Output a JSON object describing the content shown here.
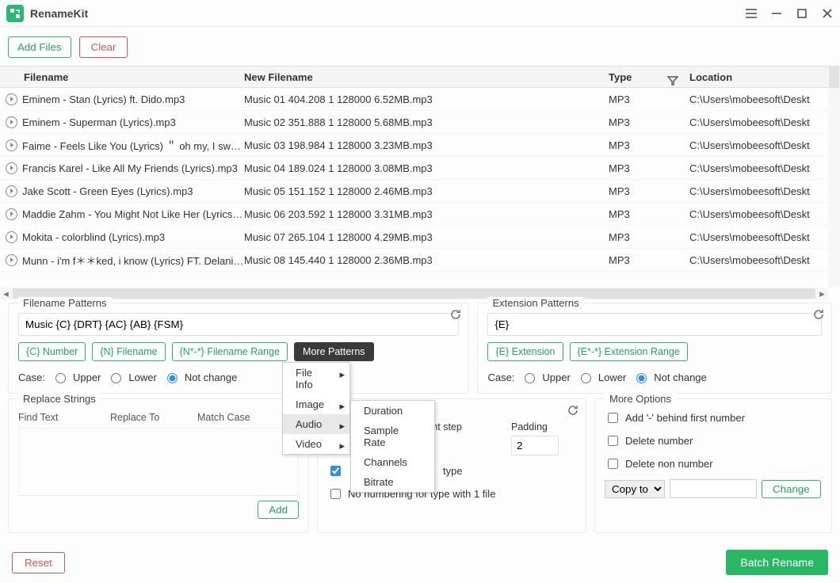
{
  "app": {
    "title": "RenameKit"
  },
  "toolbar": {
    "add_files": "Add Files",
    "clear": "Clear"
  },
  "columns": {
    "filename": "Filename",
    "new_filename": "New Filename",
    "type": "Type",
    "location": "Location"
  },
  "rows": [
    {
      "file": "Eminem - Stan (Lyrics) ft. Dido.mp3",
      "newf": "Music 01 404.208 1 128000 6.52MB.mp3",
      "type": "MP3",
      "loc": "C:\\Users\\mobeesoft\\Deskt"
    },
    {
      "file": "Eminem - Superman (Lyrics).mp3",
      "newf": "Music 02 351.888 1 128000 5.68MB.mp3",
      "type": "MP3",
      "loc": "C:\\Users\\mobeesoft\\Deskt"
    },
    {
      "file": "Faime - Feels Like You (Lyrics) ＂ oh my, I swear I ca",
      "newf": "Music 03 198.984 1 128000 3.23MB.mp3",
      "type": "MP3",
      "loc": "C:\\Users\\mobeesoft\\Deskt"
    },
    {
      "file": "Francis Karel - Like All My Friends (Lyrics).mp3",
      "newf": "Music 04 189.024 1 128000 3.08MB.mp3",
      "type": "MP3",
      "loc": "C:\\Users\\mobeesoft\\Deskt"
    },
    {
      "file": "Jake Scott - Green Eyes (Lyrics).mp3",
      "newf": "Music 05 151.152 1 128000 2.46MB.mp3",
      "type": "MP3",
      "loc": "C:\\Users\\mobeesoft\\Deskt"
    },
    {
      "file": "Maddie Zahm - You Might Not Like Her (Lyrics).mp",
      "newf": "Music 06 203.592 1 128000 3.31MB.mp3",
      "type": "MP3",
      "loc": "C:\\Users\\mobeesoft\\Deskt"
    },
    {
      "file": "Mokita - colorblind (Lyrics).mp3",
      "newf": "Music 07 265.104 1 128000 4.29MB.mp3",
      "type": "MP3",
      "loc": "C:\\Users\\mobeesoft\\Deskt"
    },
    {
      "file": "Munn - i'm f＊＊ked, i know (Lyrics) FT. Delanie Le",
      "newf": "Music 08 145.440 1 128000 2.36MB.mp3",
      "type": "MP3",
      "loc": "C:\\Users\\mobeesoft\\Deskt"
    }
  ],
  "filename_patterns": {
    "title": "Filename Patterns",
    "value": "Music {C} {DRT} {AC} {AB} {FSM}",
    "c_number": "{C} Number",
    "n_filename": "{N} Filename",
    "n_range": "{N*-*} Filename Range",
    "more": "More Patterns",
    "case": "Case:",
    "upper": "Upper",
    "lower": "Lower",
    "notchange": "Not change"
  },
  "extension_patterns": {
    "title": "Extension Patterns",
    "value": "{E}",
    "e_ext": "{E} Extension",
    "e_range": "{E*-*} Extension Range",
    "case": "Case:",
    "upper": "Upper",
    "lower": "Lower",
    "notchange": "Not change"
  },
  "more_menu": {
    "file_info": "File Info",
    "image": "Image",
    "audio": "Audio",
    "video": "Video",
    "duration": "Duration",
    "sample_rate": "Sample Rate",
    "channels": "Channels",
    "bitrate": "Bitrate"
  },
  "replace": {
    "title": "Replace Strings",
    "find": "Find Text",
    "to": "Replace To",
    "match": "Match Case",
    "add": "Add"
  },
  "numbering": {
    "step_label": "ement step",
    "padding_label": "Padding",
    "padding_value": "2",
    "type_label": "type",
    "no_num": "No numbering for type with 1 file"
  },
  "options": {
    "title": "More Options",
    "add_dash": "Add '-' behind first number",
    "del_num": "Delete number",
    "del_nonnum": "Delete non number",
    "copy_to": "Copy to",
    "change": "Change"
  },
  "footer": {
    "reset": "Reset",
    "batch": "Batch Rename"
  }
}
